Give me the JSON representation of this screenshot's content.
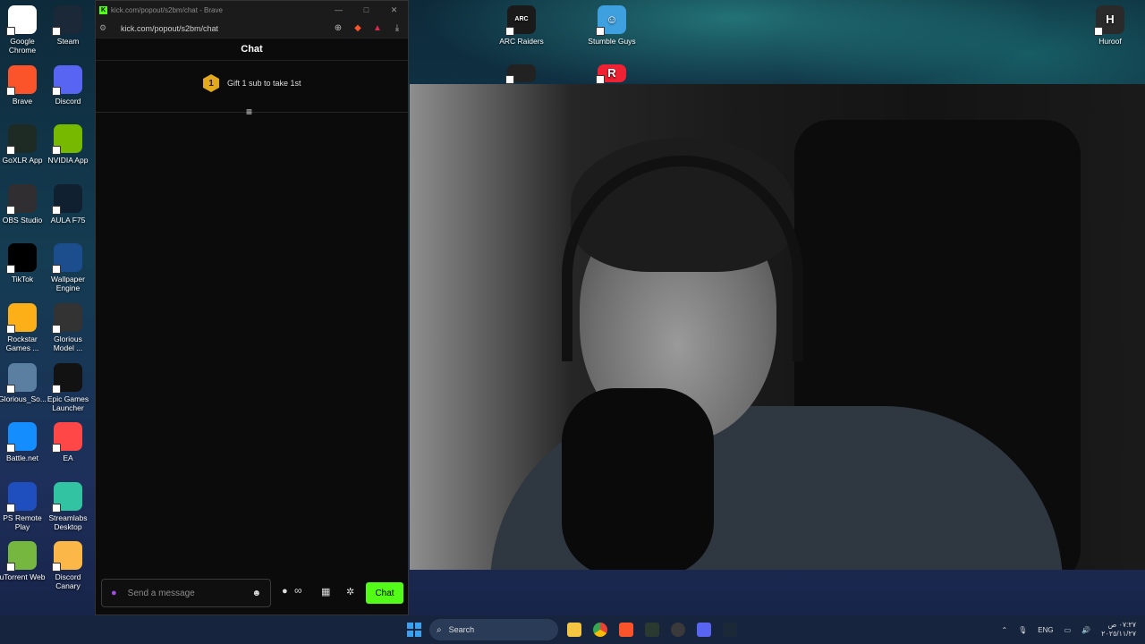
{
  "desktop_icons": [
    {
      "label": "Google Chrome",
      "icon": "chrome-icon",
      "color": "#ffffff"
    },
    {
      "label": "Steam",
      "icon": "steam-icon",
      "color": "#1b2838"
    },
    {
      "label": "Brave",
      "icon": "brave-icon",
      "color": "#fb542b"
    },
    {
      "label": "Discord",
      "icon": "discord-icon",
      "color": "#5865f2"
    },
    {
      "label": "GoXLR App",
      "icon": "goxlr-icon",
      "color": "#1e2a24"
    },
    {
      "label": "NVIDIA App",
      "icon": "nvidia-icon",
      "color": "#76b900"
    },
    {
      "label": "OBS Studio",
      "icon": "obs-icon",
      "color": "#302e31"
    },
    {
      "label": "AULA F75",
      "icon": "aula-icon",
      "color": "#102030"
    },
    {
      "label": "TikTok",
      "icon": "tiktok-icon",
      "color": "#000000"
    },
    {
      "label": "Wallpaper Engine",
      "icon": "wallpaper-engine-icon",
      "color": "#1c4d8c"
    },
    {
      "label": "Rockstar Games ...",
      "icon": "rockstar-icon",
      "color": "#fcaf17"
    },
    {
      "label": "Glorious Model ...",
      "icon": "glorious-mouse-icon",
      "color": "#333333"
    },
    {
      "label": "Glorious_So...",
      "icon": "glorious-software-icon",
      "color": "#5a7fa0"
    },
    {
      "label": "Epic Games Launcher",
      "icon": "epic-games-icon",
      "color": "#121212"
    },
    {
      "label": "Battle.net",
      "icon": "battlenet-icon",
      "color": "#148eff"
    },
    {
      "label": "EA",
      "icon": "ea-icon",
      "color": "#ff4747"
    },
    {
      "label": "PS Remote Play",
      "icon": "ps-remote-play-icon",
      "color": "#1f4fbf"
    },
    {
      "label": "Streamlabs Desktop",
      "icon": "streamlabs-icon",
      "color": "#31c3a2"
    },
    {
      "label": "uTorrent Web",
      "icon": "utorrent-icon",
      "color": "#76b83f"
    },
    {
      "label": "Discord Canary",
      "icon": "discord-canary-icon",
      "color": "#fbb848"
    }
  ],
  "desktop_icons_right": [
    {
      "label": "ARC Raiders",
      "icon": "arc-raiders-icon",
      "color": "#1a1a1a"
    },
    {
      "label": "Stumble Guys",
      "icon": "stumble-guys-icon",
      "color": "#3fa0e0"
    },
    {
      "label": "Huroof",
      "icon": "huroof-icon",
      "color": "#2a2a2a",
      "glyph": "H"
    }
  ],
  "browser": {
    "title": "kick.com/popout/s2bm/chat - Brave",
    "url": "kick.com/popout/s2bm/chat",
    "favicon": "K"
  },
  "chat": {
    "header": "Chat",
    "gift_rank": "1",
    "gift_text": "Gift 1 sub to take 1st",
    "input_placeholder": "Send a message",
    "infinity": "∞",
    "send_label": "Chat",
    "accent": "#53fc18"
  },
  "taskbar": {
    "search_label": "Search",
    "language": "ENG",
    "time": "٠٧:٢٧ ص",
    "date": "٢٠٢٥/١١/٢٧"
  }
}
